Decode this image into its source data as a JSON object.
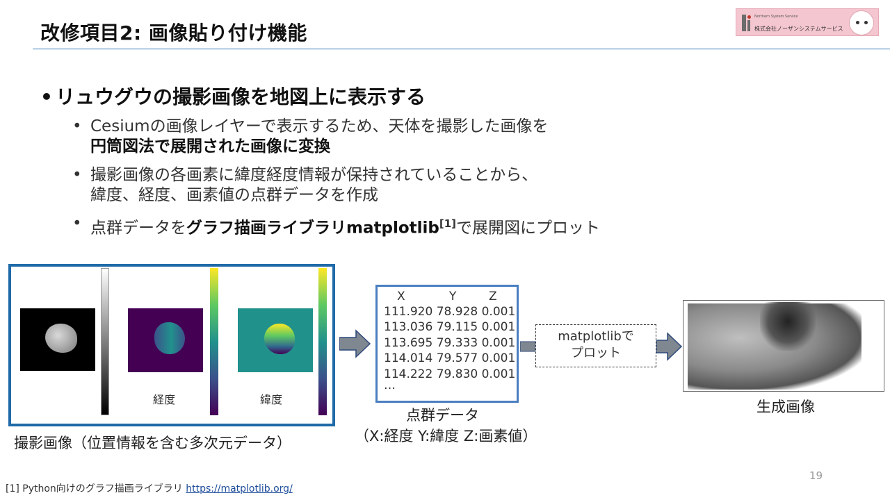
{
  "slide": {
    "title": "改修項目2: 画像貼り付け機能",
    "page_number": "19"
  },
  "logo": {
    "company": "株式会社ノーザンシステムサービス",
    "tagline": "Northern System Service"
  },
  "main_bullet": {
    "text": "リュウグウの撮影画像を地図上に表示する"
  },
  "sub_bullets": [
    {
      "plain": "Cesiumの画像レイヤーで表示するため、天体を撮影した画像を",
      "bold": "円筒図法で展開された画像に変換"
    },
    {
      "line1": "撮影画像の各画素に緯度経度情報が保持されていることから、",
      "line2": "緯度、経度、画素値の点群データを作成"
    },
    {
      "before": "点群データを",
      "bold": "グラフ描画ライブラリmatplotlib",
      "sup": "[1]",
      "after": "で展開図にプロット"
    }
  ],
  "figure": {
    "panel_labels": [
      "経度",
      "緯度"
    ],
    "frame_caption": "撮影画像（位置情報を含む多次元データ）",
    "table": {
      "headers": [
        "X",
        "Y",
        "Z"
      ],
      "rows": [
        [
          "111.920",
          "78.928",
          "0.001"
        ],
        [
          "113.036",
          "79.115",
          "0.001"
        ],
        [
          "113.695",
          "79.333",
          "0.001"
        ],
        [
          "114.014",
          "79.577",
          "0.001"
        ],
        [
          "114.222",
          "79.830",
          "0.001"
        ]
      ],
      "ellipsis": "…",
      "caption_line1": "点群データ",
      "caption_line2": "（X:経度 Y:緯度 Z:画素値）"
    },
    "process_box": {
      "line1": "matplotlibで",
      "line2": "プロット"
    },
    "result_caption": "生成画像",
    "colors": {
      "frame_border": "#1f6aa8",
      "table_border": "#4a7ec0",
      "arrow": "#7f8790"
    }
  },
  "footnote": {
    "text": "[1] Python向けのグラフ描画ライブラリ ",
    "link": "https://matplotlib.org/"
  }
}
